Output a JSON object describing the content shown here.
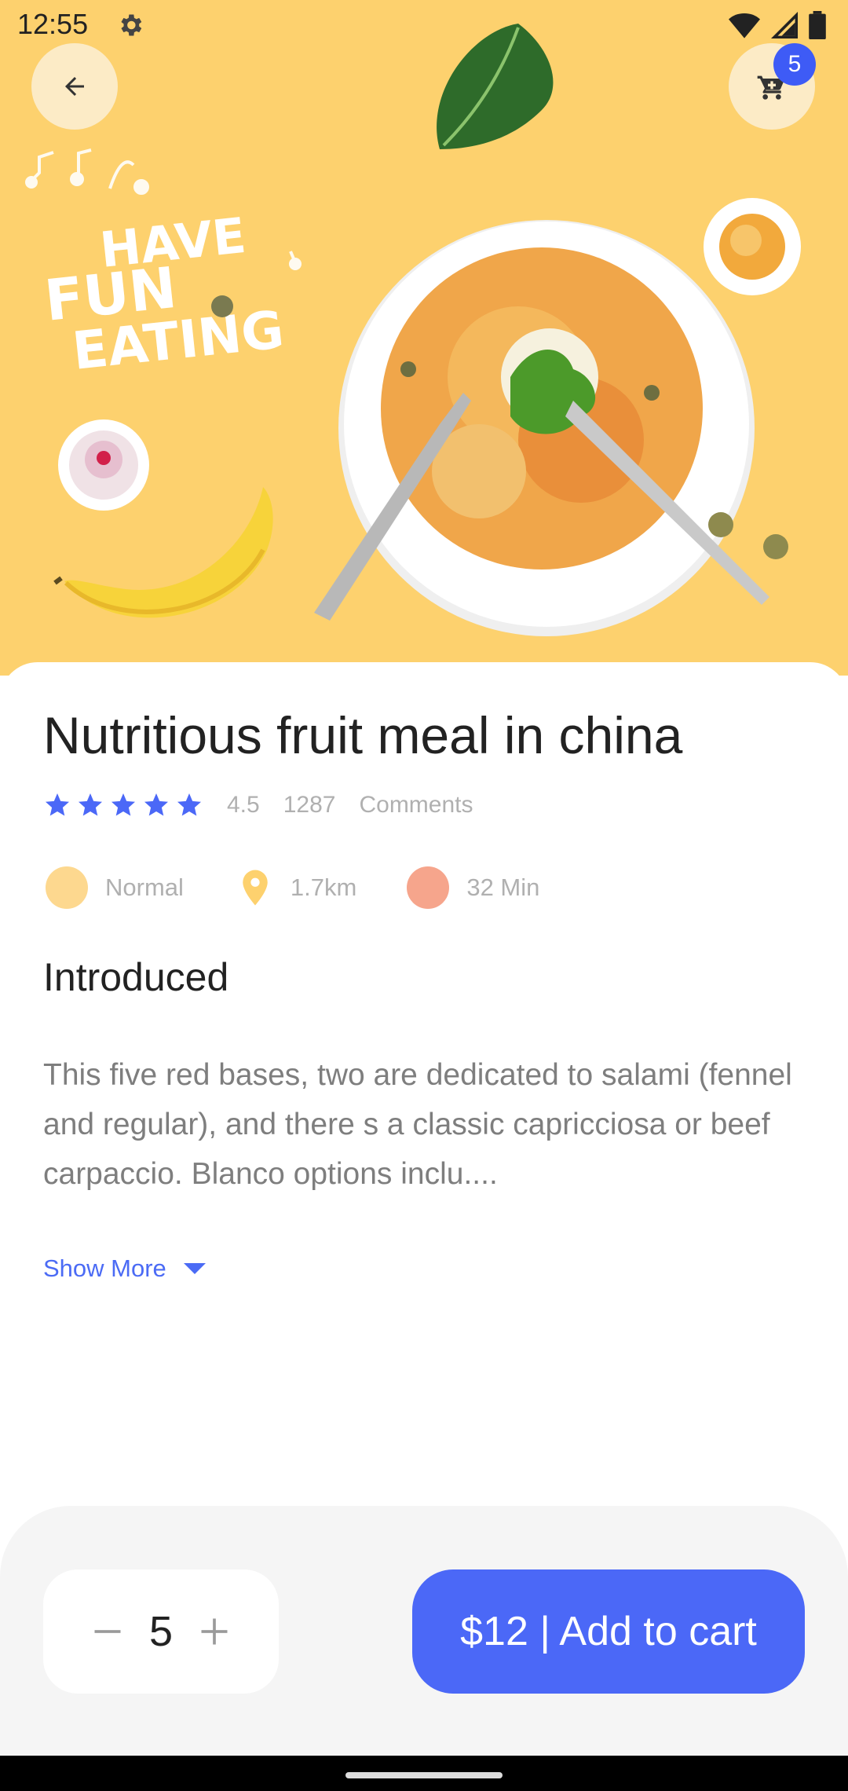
{
  "status_bar": {
    "time": "12:55"
  },
  "header": {
    "cart_count": "5"
  },
  "hero": {
    "headline_lines": [
      "HAVE",
      "FUN",
      "EATING"
    ]
  },
  "product": {
    "title": "Nutritious fruit meal in china",
    "rating_value": "4.5",
    "rating_stars": 5,
    "review_count": "1287",
    "comments_label": "Comments"
  },
  "info": [
    {
      "label": "Normal",
      "color": "#FDD88F"
    },
    {
      "label": "1.7km",
      "color": "#FDD16E"
    },
    {
      "label": "32 Min",
      "color": "#F6A58C"
    }
  ],
  "intro": {
    "heading": "Introduced",
    "description": "This five red bases, two are dedicated to salami (fennel and regular), and there s a classic capricciosa or beef carpaccio. Blanco options inclu....",
    "show_more": "Show More"
  },
  "cart": {
    "quantity": "5",
    "add_button": "$12 | Add to cart"
  },
  "colors": {
    "hero_bg": "#FDD16E",
    "accent": "#4B68F7",
    "badge": "#3E5BF6"
  }
}
